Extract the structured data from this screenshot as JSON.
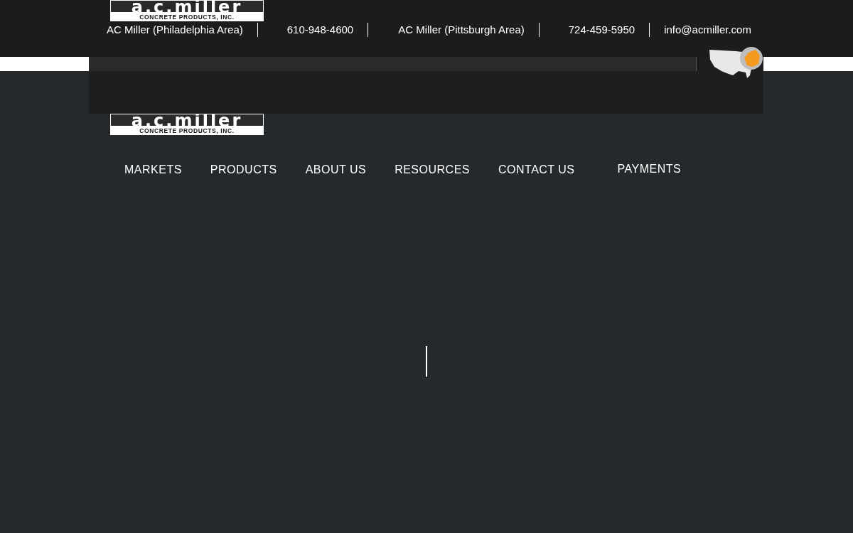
{
  "contact_bar": [
    {
      "text": "AC Miller (Philadelphia Area)"
    },
    {
      "text": "610-948-4600"
    },
    {
      "text": "AC Miller (Pittsburgh Area)"
    },
    {
      "text": "724-459-5950"
    },
    {
      "text": "info@acmiller.com"
    }
  ],
  "logos": [
    {
      "wordmark": "a.c.miller",
      "tagline": "CONCRETE PRODUCTS, INC."
    },
    {
      "wordmark": "a.c.miller",
      "tagline": "CONCRETE PRODUCTS, INC."
    }
  ],
  "nav": [
    {
      "label": "MARKETS"
    },
    {
      "label": "PRODUCTS"
    },
    {
      "label": "ABOUT US"
    },
    {
      "label": "RESOURCES"
    },
    {
      "label": "CONTACT US"
    },
    {
      "label": "PAYMENTS"
    }
  ]
}
